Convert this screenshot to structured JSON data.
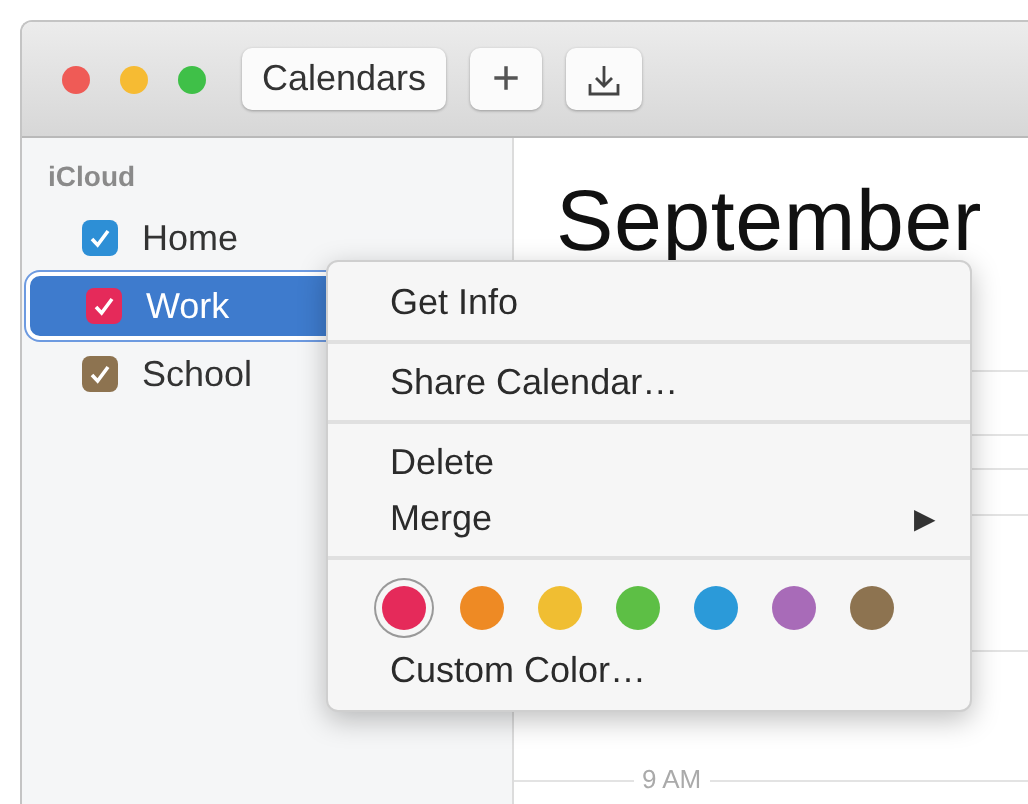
{
  "toolbar": {
    "buttons": [
      {
        "kind": "text",
        "label": "Calendars"
      },
      {
        "kind": "text",
        "label": "+"
      },
      {
        "kind": "download"
      }
    ]
  },
  "sidebar": {
    "group": "iCloud",
    "calendars": [
      {
        "name": "Home",
        "checked": true,
        "color": "#2d8fd6",
        "selected": false
      },
      {
        "name": "Work",
        "checked": true,
        "color": "#e52a5a",
        "selected": true
      },
      {
        "name": "School",
        "checked": true,
        "color": "#8d7350",
        "selected": false
      }
    ]
  },
  "main": {
    "month": "September",
    "time_label": "9 AM"
  },
  "context_menu": {
    "items": [
      {
        "kind": "item",
        "label": "Get Info"
      },
      {
        "kind": "separator"
      },
      {
        "kind": "item",
        "label": "Share Calendar…"
      },
      {
        "kind": "separator"
      },
      {
        "kind": "item",
        "label": "Delete"
      },
      {
        "kind": "item",
        "label": "Merge",
        "arrow": "▶"
      },
      {
        "kind": "separator"
      },
      {
        "kind": "swatches",
        "swatches": [
          {
            "color": "#e52a5a",
            "selected": true
          },
          {
            "color": "#ee8a24",
            "selected": false
          },
          {
            "color": "#f0be32",
            "selected": false
          },
          {
            "color": "#5dbf45",
            "selected": false
          },
          {
            "color": "#2b9ad9",
            "selected": false
          },
          {
            "color": "#a86bb8",
            "selected": false
          },
          {
            "color": "#8d7350",
            "selected": false
          }
        ]
      },
      {
        "kind": "item",
        "label": "Custom Color…"
      }
    ]
  }
}
